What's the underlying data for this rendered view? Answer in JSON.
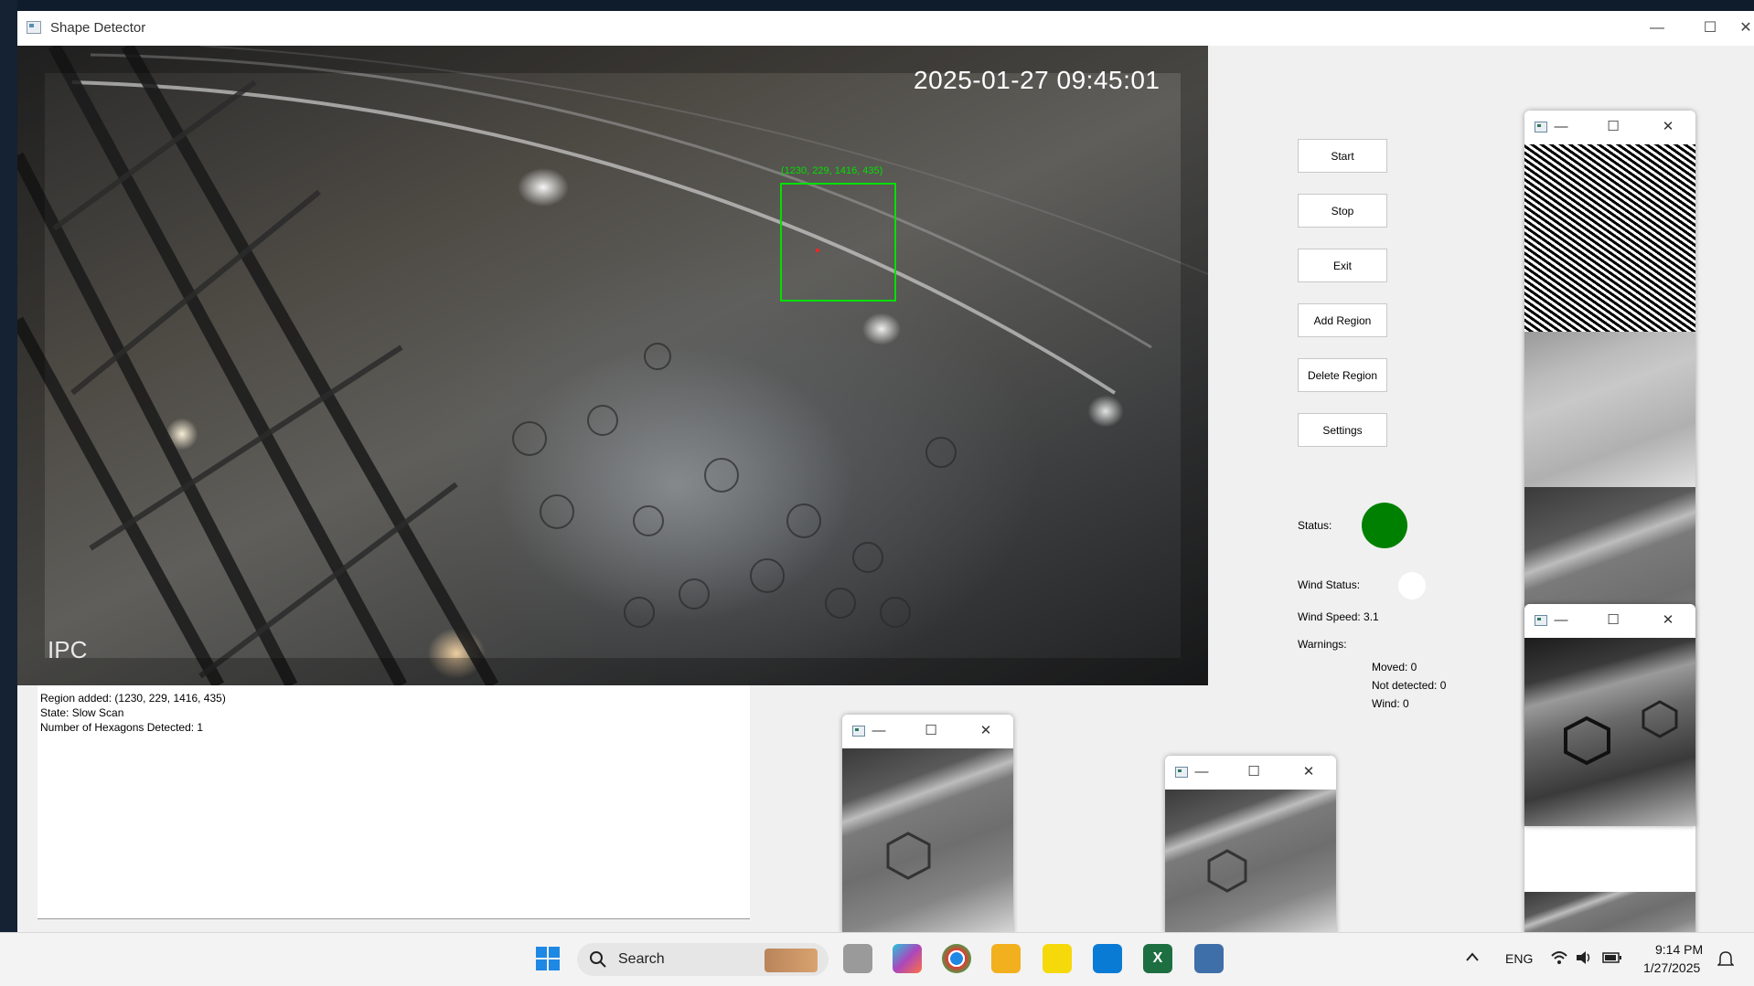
{
  "window": {
    "title": "Shape Detector",
    "minimize": "—",
    "maximize": "☐",
    "close": "✕"
  },
  "camera": {
    "timestamp": "2025-01-27 09:45:01",
    "watermark": "IPC",
    "roi_label": "(1230, 229, 1416, 435)"
  },
  "log": {
    "lines": [
      "Region added: (1230, 229, 1416, 435)",
      "State: Slow Scan",
      "Number of Hexagons Detected: 1"
    ]
  },
  "buttons": {
    "start": "Start",
    "stop": "Stop",
    "exit": "Exit",
    "add_region": "Add Region",
    "delete_region": "Delete Region",
    "settings": "Settings"
  },
  "status": {
    "status_label": "Status:",
    "status_color": "#008000",
    "wind_status_label": "Wind Status:",
    "wind_status_color": "#ffffff",
    "wind_speed": "Wind Speed: 3.1",
    "warnings_label": "Warnings:",
    "moved": "Moved: 0",
    "not_detected": "Not detected: 0",
    "wind": "Wind: 0"
  },
  "popups": {
    "minimize": "—",
    "maximize": "☐",
    "close": "✕"
  },
  "taskbar": {
    "search": "Search",
    "language": "ENG",
    "time": "9:14 PM",
    "date": "1/27/2025",
    "excel_letter": "X"
  }
}
